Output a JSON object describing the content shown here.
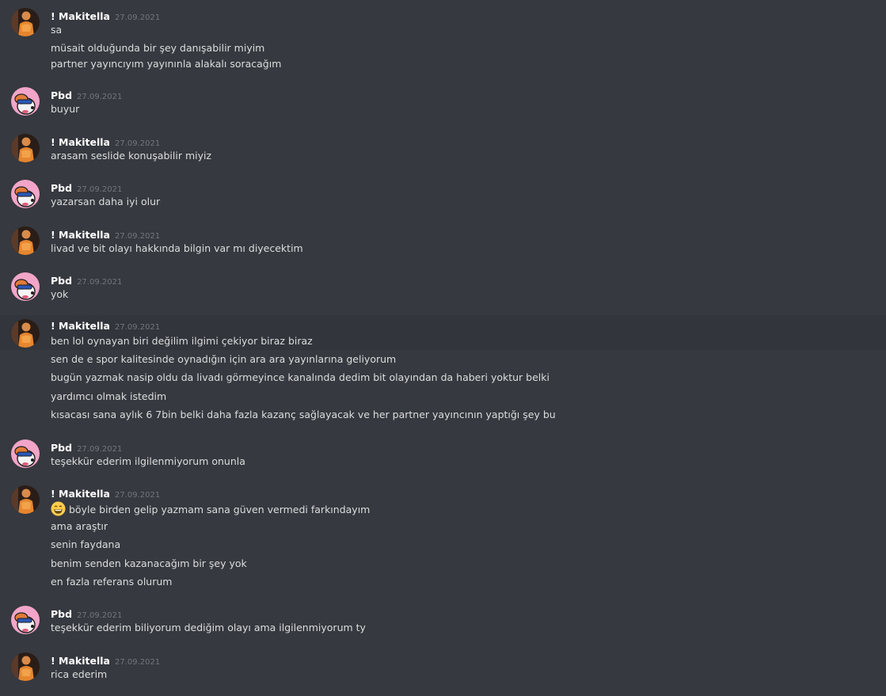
{
  "users": {
    "makitella": {
      "name": "! Makitella",
      "avatar_icon": "orange-figure-avatar-icon"
    },
    "pbd": {
      "name": "Pbd",
      "avatar_icon": "cartoon-dog-avatar-icon"
    }
  },
  "colors": {
    "background": "#36393f",
    "hover_background": "#32353b",
    "username": "#ffffff",
    "message_text": "#dcddde",
    "timestamp": "#72767d"
  },
  "messages": [
    {
      "user": "! Makitella",
      "time": "27.09.2021",
      "lines": [
        "sa",
        "müsait olduğunda bir şey danışabilir miyim",
        "partner yayıncıyım yayınınla alakalı soracağım"
      ]
    },
    {
      "user": "Pbd",
      "time": "27.09.2021",
      "lines": [
        "buyur"
      ]
    },
    {
      "user": "! Makitella",
      "time": "27.09.2021",
      "lines": [
        "arasam seslide konuşabilir miyiz"
      ]
    },
    {
      "user": "Pbd",
      "time": "27.09.2021",
      "lines": [
        "yazarsan daha iyi olur"
      ]
    },
    {
      "user": "! Makitella",
      "time": "27.09.2021",
      "lines": [
        "livad ve bit olayı hakkında bilgin var mı diyecektim"
      ]
    },
    {
      "user": "Pbd",
      "time": "27.09.2021",
      "lines": [
        "yok"
      ]
    },
    {
      "user": "! Makitella",
      "time": "27.09.2021",
      "lines": [
        "ben lol oynayan biri değilim ilgimi çekiyor biraz biraz",
        "sen de e spor kalitesinde oynadığın için ara ara yayınlarına geliyorum",
        "bugün yazmak nasip oldu da livadı görmeyince kanalında dedim bit olayından da haberi yoktur belki",
        "yardımcı olmak istedim",
        "kısacası sana aylık 6 7bin belki daha fazla kazanç sağlayacak ve her partner yayıncının yaptığı şey bu"
      ]
    },
    {
      "user": "Pbd",
      "time": "27.09.2021",
      "lines": [
        "teşekkür ederim ilgilenmiyorum onunla"
      ]
    },
    {
      "user": "! Makitella",
      "time": "27.09.2021",
      "emoji_icon": "grinning-face-emoji-icon",
      "lines": [
        "böyle birden gelip yazmam sana güven vermedi farkındayım",
        "ama araştır",
        "senin faydana",
        "benim senden kazanacağım bir şey yok",
        "en fazla referans olurum"
      ]
    },
    {
      "user": "Pbd",
      "time": "27.09.2021",
      "lines": [
        "teşekkür ederim biliyorum dediğim olayı ama ilgilenmiyorum ty"
      ]
    },
    {
      "user": "! Makitella",
      "time": "27.09.2021",
      "lines": [
        "rica ederim"
      ]
    }
  ]
}
